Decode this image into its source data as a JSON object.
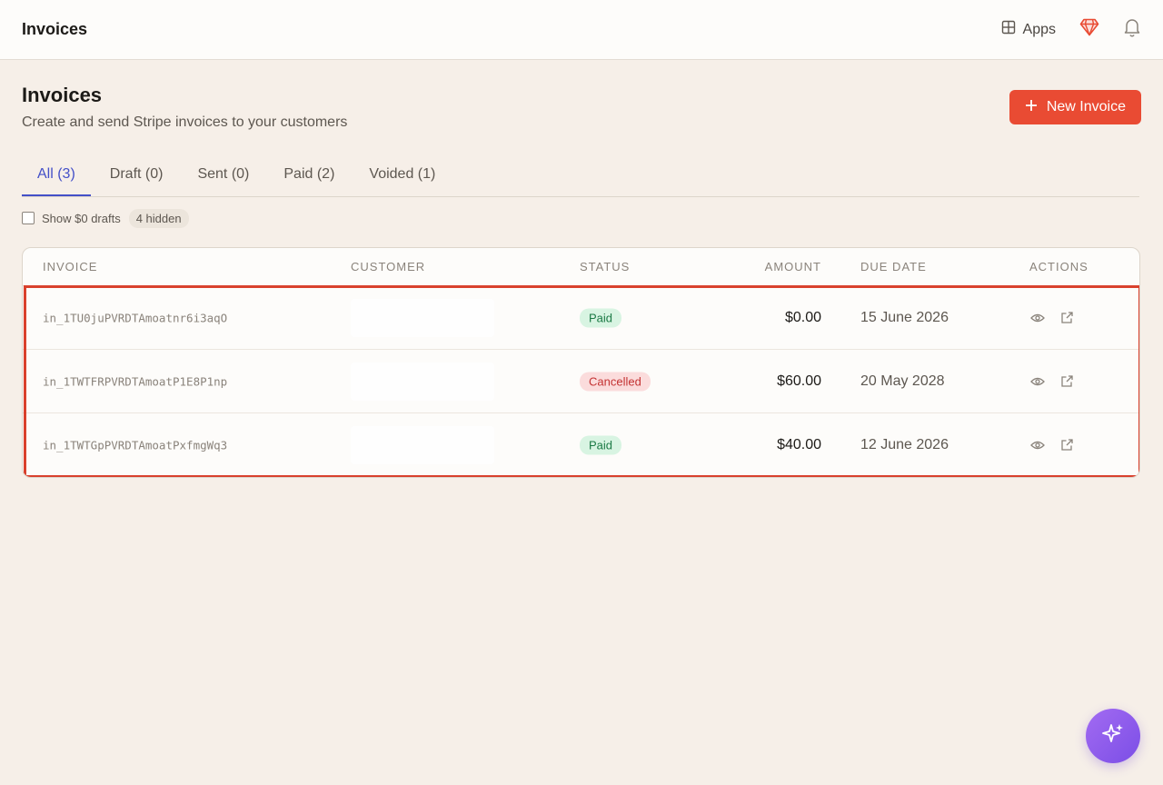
{
  "topbar": {
    "title": "Invoices",
    "apps_label": "Apps",
    "icons": [
      "grid-icon",
      "gem-icon",
      "bell-icon"
    ]
  },
  "header": {
    "title": "Invoices",
    "subtitle": "Create and send Stripe invoices to your customers",
    "new_invoice_label": "New Invoice"
  },
  "tabs": [
    {
      "label": "All (3)",
      "active": true
    },
    {
      "label": "Draft (0)",
      "active": false
    },
    {
      "label": "Sent (0)",
      "active": false
    },
    {
      "label": "Paid (2)",
      "active": false
    },
    {
      "label": "Voided (1)",
      "active": false
    }
  ],
  "filter": {
    "checkbox_label": "Show $0 drafts",
    "checked": false,
    "hidden_badge": "4 hidden"
  },
  "table": {
    "columns": [
      "INVOICE",
      "CUSTOMER",
      "STATUS",
      "AMOUNT",
      "DUE DATE",
      "ACTIONS"
    ],
    "rows": [
      {
        "invoice": "in_1TU0juPVRDTAmoatnr6i3aqO",
        "customer": "",
        "status": "Paid",
        "amount": "$0.00",
        "due": "15 June 2026"
      },
      {
        "invoice": "in_1TWTFRPVRDTAmoatP1E8P1np",
        "customer": "",
        "status": "Cancelled",
        "amount": "$60.00",
        "due": "20 May 2028"
      },
      {
        "invoice": "in_1TWTGpPVRDTAmoatPxfmgWq3",
        "customer": "",
        "status": "Paid",
        "amount": "$40.00",
        "due": "12 June 2026"
      }
    ]
  },
  "colors": {
    "accent": "#e94b33",
    "tab_active": "#4450c8",
    "highlight": "#d9412d",
    "paid_bg": "#d8f4e2",
    "cancelled_bg": "#fbdcdc",
    "fab_gradient": [
      "#a36bf2",
      "#7b4ee6"
    ]
  }
}
